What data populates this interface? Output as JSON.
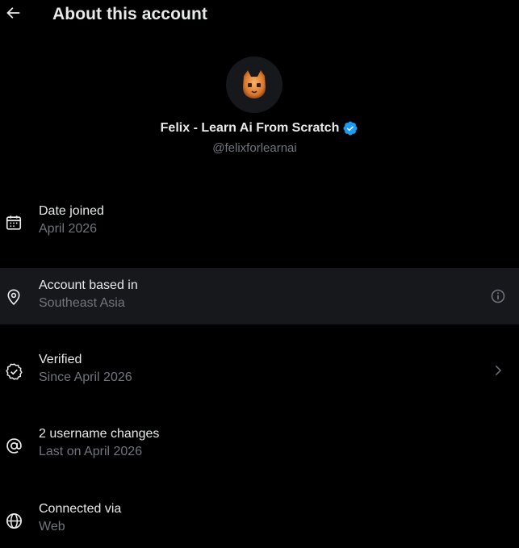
{
  "header": {
    "title": "About this account",
    "back_icon": "arrow-left-icon"
  },
  "profile": {
    "display_name": "Felix - Learn Ai From Scratch",
    "handle": "@felixforlearnai",
    "verified_badge_color": "#1d9bf0",
    "avatar_icon": "cat-avatar"
  },
  "details": [
    {
      "label": "Date joined",
      "value": "April 2026",
      "icon": "calendar-icon"
    },
    {
      "label": "Account based in",
      "value": "Southeast Asia",
      "icon": "location-pin-icon",
      "trailing_icon": "info-icon"
    },
    {
      "label": "Verified",
      "value": "Since April 2026",
      "icon": "verified-badge-icon",
      "trailing_icon": "chevron-right-icon"
    },
    {
      "label": "2 username changes",
      "value": "Last on April 2026",
      "icon": "at-sign-icon"
    },
    {
      "label": "Connected via",
      "value": "Web",
      "icon": "globe-icon"
    }
  ],
  "colors": {
    "background": "#000000",
    "primary_text": "#e7e9ea",
    "secondary_text": "#71767b",
    "hover_row": "#16181c",
    "accent": "#1d9bf0"
  }
}
